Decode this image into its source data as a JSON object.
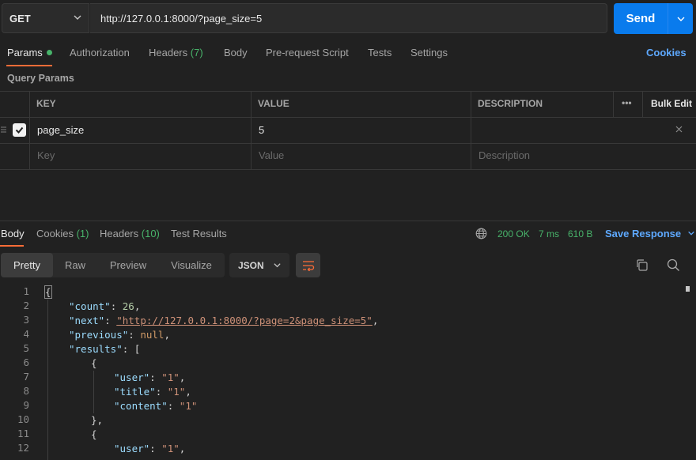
{
  "request": {
    "method": "GET",
    "url": "http://127.0.0.1:8000/?page_size=5",
    "send_label": "Send"
  },
  "req_tabs": [
    {
      "label": "Params",
      "count": ""
    },
    {
      "label": "Authorization",
      "count": ""
    },
    {
      "label": "Headers",
      "count": "(7)"
    },
    {
      "label": "Body",
      "count": ""
    },
    {
      "label": "Pre-request Script",
      "count": ""
    },
    {
      "label": "Tests",
      "count": ""
    },
    {
      "label": "Settings",
      "count": ""
    }
  ],
  "cookies_link": "Cookies",
  "query_params_title": "Query Params",
  "table": {
    "headers": {
      "key": "KEY",
      "value": "VALUE",
      "description": "DESCRIPTION",
      "bulk_edit": "Bulk Edit",
      "more": "•••"
    },
    "rows": [
      {
        "key": "page_size",
        "value": "5",
        "description": ""
      }
    ],
    "placeholders": {
      "key": "Key",
      "value": "Value",
      "description": "Description"
    }
  },
  "resp_tabs": [
    {
      "label": "Body",
      "count": ""
    },
    {
      "label": "Cookies",
      "count": "(1)"
    },
    {
      "label": "Headers",
      "count": "(10)"
    },
    {
      "label": "Test Results",
      "count": ""
    }
  ],
  "status": {
    "code": "200 OK",
    "time": "7 ms",
    "size": "610 B",
    "save_label": "Save Response"
  },
  "view_modes": [
    "Pretty",
    "Raw",
    "Preview",
    "Visualize"
  ],
  "format": "JSON",
  "code_lines": [
    {
      "n": "1"
    },
    {
      "n": "2"
    },
    {
      "n": "3"
    },
    {
      "n": "4"
    },
    {
      "n": "5"
    },
    {
      "n": "6"
    },
    {
      "n": "7"
    },
    {
      "n": "8"
    },
    {
      "n": "9"
    },
    {
      "n": "10"
    },
    {
      "n": "11"
    },
    {
      "n": "12"
    }
  ],
  "json": {
    "count_key": "\"count\"",
    "count_val": "26",
    "next_key": "\"next\"",
    "next_val": "\"http://127.0.0.1:8000/?page=2&page_size=5\"",
    "previous_key": "\"previous\"",
    "previous_val": "null",
    "results_key": "\"results\"",
    "user_key": "\"user\"",
    "user_val": "\"1\"",
    "title_key": "\"title\"",
    "title_val": "\"1\"",
    "content_key": "\"content\"",
    "content_val": "\"1\""
  },
  "colors": {
    "accent": "#ff6c37",
    "send": "#097bed",
    "link": "#5ea9ff",
    "success": "#48b36a"
  }
}
